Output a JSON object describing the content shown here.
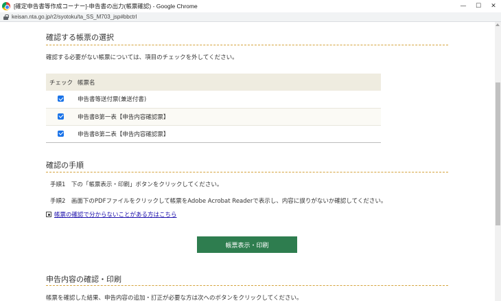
{
  "window": {
    "title": "[確定申告書等作成コーナー]-申告書の出力(帳票確認) - Google Chrome",
    "controls": {
      "minimize": "—",
      "maximize": "☐",
      "close": "✕"
    }
  },
  "address_bar": {
    "url": "keisan.nta.go.jp/r2/syotoku/ta_SS_M703_jsp#bbctrl"
  },
  "select_forms": {
    "heading": "確認する帳票の選択",
    "description": "確認する必要がない帳票については、項目のチェックを外してください。",
    "table": {
      "columns": [
        "チェック",
        "帳票名"
      ],
      "rows": [
        {
          "checked": true,
          "name": "申告書等送付票(兼送付書)"
        },
        {
          "checked": true,
          "name": "申告書B第一表【申告内容確認票】"
        },
        {
          "checked": true,
          "name": "申告書B第二表【申告内容確認票】"
        }
      ]
    }
  },
  "confirm_steps": {
    "heading": "確認の手順",
    "steps": [
      "手順1　下の「帳票表示・印刷」ボタンをクリックしてください。",
      "手順2　画面下のPDFファイルをクリックして帳票をAdobe Acrobat Readerで表示し、内容に誤りがないか確認してください。"
    ],
    "help_link": "帳票の確認で分からないことがある方はこちら"
  },
  "print_button": {
    "label": "帳票表示・印刷"
  },
  "next_section": {
    "heading": "申告内容の確認・印刷",
    "description": "帳票を確認した結果、申告内容の追加・訂正が必要な方は次へのボタンをクリックしてください。"
  },
  "colors": {
    "accent_green": "#2e7d4f",
    "divider_gold": "#d4a23a",
    "table_header_bg": "#efece0",
    "checkbox_blue": "#1a73e8"
  }
}
